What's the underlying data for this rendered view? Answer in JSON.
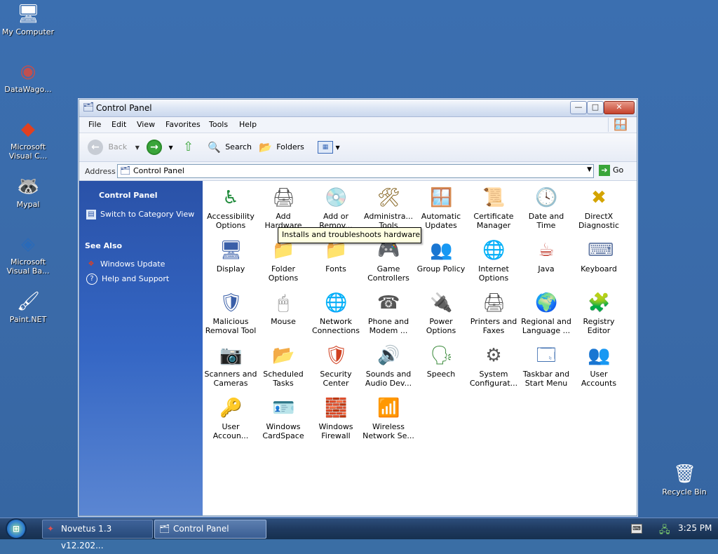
{
  "desktop": {
    "icons": [
      {
        "label": "My Computer",
        "glyph": "🖥",
        "icon": "my-computer-icon"
      },
      {
        "label": "DataWago...",
        "glyph": "◉",
        "icon": "datawagon-icon"
      },
      {
        "label": "Microsoft Visual C...",
        "glyph": "◆",
        "icon": "visual-c-icon"
      },
      {
        "label": "Mypal",
        "glyph": "🦝",
        "icon": "mypal-icon"
      },
      {
        "label": "Microsoft Visual Ba...",
        "glyph": "◈",
        "icon": "visual-basic-icon"
      },
      {
        "label": "Paint.NET",
        "glyph": "🖌",
        "icon": "paint-net-icon"
      },
      {
        "label": "Recycle Bin",
        "glyph": "🗑",
        "icon": "recycle-bin-icon"
      }
    ]
  },
  "window": {
    "title": "Control Panel",
    "controls": {
      "minimize": "—",
      "maximize": "□",
      "close": "✕"
    },
    "menu": [
      "File",
      "Edit",
      "View",
      "Favorites",
      "Tools",
      "Help"
    ],
    "toolbar": {
      "back_label": "Back",
      "search_label": "Search",
      "folders_label": "Folders"
    },
    "address": {
      "label": "Address",
      "value": "Control Panel",
      "go_label": "Go"
    }
  },
  "taskpane": {
    "title": "Control Panel",
    "switch_label": "Switch to Category View",
    "see_also_heading": "See Also",
    "see_also": [
      "Windows Update",
      "Help and Support"
    ]
  },
  "items": [
    {
      "label": "Accessibility Options",
      "glyph": "♿",
      "icon": "accessibility-options-icon",
      "color": "#1e8a3a"
    },
    {
      "label": "Add Hardware",
      "glyph": "🖨",
      "icon": "add-hardware-icon",
      "color": "#555555"
    },
    {
      "label": "Add or Remov...",
      "glyph": "💿",
      "icon": "add-remove-programs-icon",
      "color": "#3a5fa8"
    },
    {
      "label": "Administra... Tools",
      "glyph": "🛠",
      "icon": "administrative-tools-icon",
      "color": "#8a6a2a"
    },
    {
      "label": "Automatic Updates",
      "glyph": "🪟",
      "icon": "automatic-updates-icon",
      "color": "#d04020"
    },
    {
      "label": "Certificate Manager",
      "glyph": "📜",
      "icon": "certificate-manager-icon",
      "color": "#2e7d32"
    },
    {
      "label": "Date and Time",
      "glyph": "🕓",
      "icon": "date-time-icon",
      "color": "#3a5fa8"
    },
    {
      "label": "DirectX Diagnostic",
      "glyph": "✖",
      "icon": "directx-diagnostic-icon",
      "color": "#d4a400"
    },
    {
      "label": "Display",
      "glyph": "🖥",
      "icon": "display-icon",
      "color": "#3a5fa8"
    },
    {
      "label": "Folder Options",
      "glyph": "📁",
      "icon": "folder-options-icon",
      "color": "#e0b030"
    },
    {
      "label": "Fonts",
      "glyph": "📁",
      "icon": "fonts-icon",
      "color": "#e0b030"
    },
    {
      "label": "Game Controllers",
      "glyph": "🎮",
      "icon": "game-controllers-icon",
      "color": "#6a5fb8"
    },
    {
      "label": "Group Policy",
      "glyph": "👥",
      "icon": "group-policy-icon",
      "color": "#333333"
    },
    {
      "label": "Internet Options",
      "glyph": "🌐",
      "icon": "internet-options-icon",
      "color": "#2a7fb8"
    },
    {
      "label": "Java",
      "glyph": "☕",
      "icon": "java-icon",
      "color": "#c0392b"
    },
    {
      "label": "Keyboard",
      "glyph": "⌨",
      "icon": "keyboard-icon",
      "color": "#6a7fa8"
    },
    {
      "label": "Malicious Removal Tool",
      "glyph": "🛡",
      "icon": "malicious-removal-tool-icon",
      "color": "#3a5fa8"
    },
    {
      "label": "Mouse",
      "glyph": "🖱",
      "icon": "mouse-icon",
      "color": "#777777"
    },
    {
      "label": "Network Connections",
      "glyph": "🌐",
      "icon": "network-connections-icon",
      "color": "#2a7fb8"
    },
    {
      "label": "Phone and Modem ...",
      "glyph": "☎",
      "icon": "phone-modem-icon",
      "color": "#555555"
    },
    {
      "label": "Power Options",
      "glyph": "🔌",
      "icon": "power-options-icon",
      "color": "#c0392b"
    },
    {
      "label": "Printers and Faxes",
      "glyph": "🖨",
      "icon": "printers-faxes-icon",
      "color": "#555555"
    },
    {
      "label": "Regional and Language ...",
      "glyph": "🌍",
      "icon": "regional-language-icon",
      "color": "#2a7fb8"
    },
    {
      "label": "Registry Editor",
      "glyph": "🧩",
      "icon": "registry-editor-icon",
      "color": "#2a8fb8"
    },
    {
      "label": "Scanners and Cameras",
      "glyph": "📷",
      "icon": "scanners-cameras-icon",
      "color": "#555555"
    },
    {
      "label": "Scheduled Tasks",
      "glyph": "📂",
      "icon": "scheduled-tasks-icon",
      "color": "#e0b030"
    },
    {
      "label": "Security Center",
      "glyph": "🛡",
      "icon": "security-center-icon",
      "color": "#d04020"
    },
    {
      "label": "Sounds and Audio Dev...",
      "glyph": "🔊",
      "icon": "sounds-audio-icon",
      "color": "#555555"
    },
    {
      "label": "Speech",
      "glyph": "🗣",
      "icon": "speech-icon",
      "color": "#3a8a3a"
    },
    {
      "label": "System Configurat...",
      "glyph": "⚙",
      "icon": "system-configuration-icon",
      "color": "#555555"
    },
    {
      "label": "Taskbar and Start Menu",
      "glyph": "🗔",
      "icon": "taskbar-start-menu-icon",
      "color": "#2a5fa8"
    },
    {
      "label": "User Accounts",
      "glyph": "👥",
      "icon": "user-accounts-icon",
      "color": "#2a7f3a"
    },
    {
      "label": "User Accoun...",
      "glyph": "🔑",
      "icon": "user-accounts-2-icon",
      "color": "#c0a020"
    },
    {
      "label": "Windows CardSpace",
      "glyph": "🪪",
      "icon": "windows-cardspace-icon",
      "color": "#6a5fb8"
    },
    {
      "label": "Windows Firewall",
      "glyph": "🧱",
      "icon": "windows-firewall-icon",
      "color": "#c0392b"
    },
    {
      "label": "Wireless Network Se...",
      "glyph": "📶",
      "icon": "wireless-network-icon",
      "color": "#3a5fa8"
    }
  ],
  "tooltip": "Installs and troubleshoots hardware",
  "taskbar": {
    "tasks": [
      "Novetus 1.3 v12.202...",
      "Control Panel"
    ],
    "clock": "3:25 PM"
  }
}
